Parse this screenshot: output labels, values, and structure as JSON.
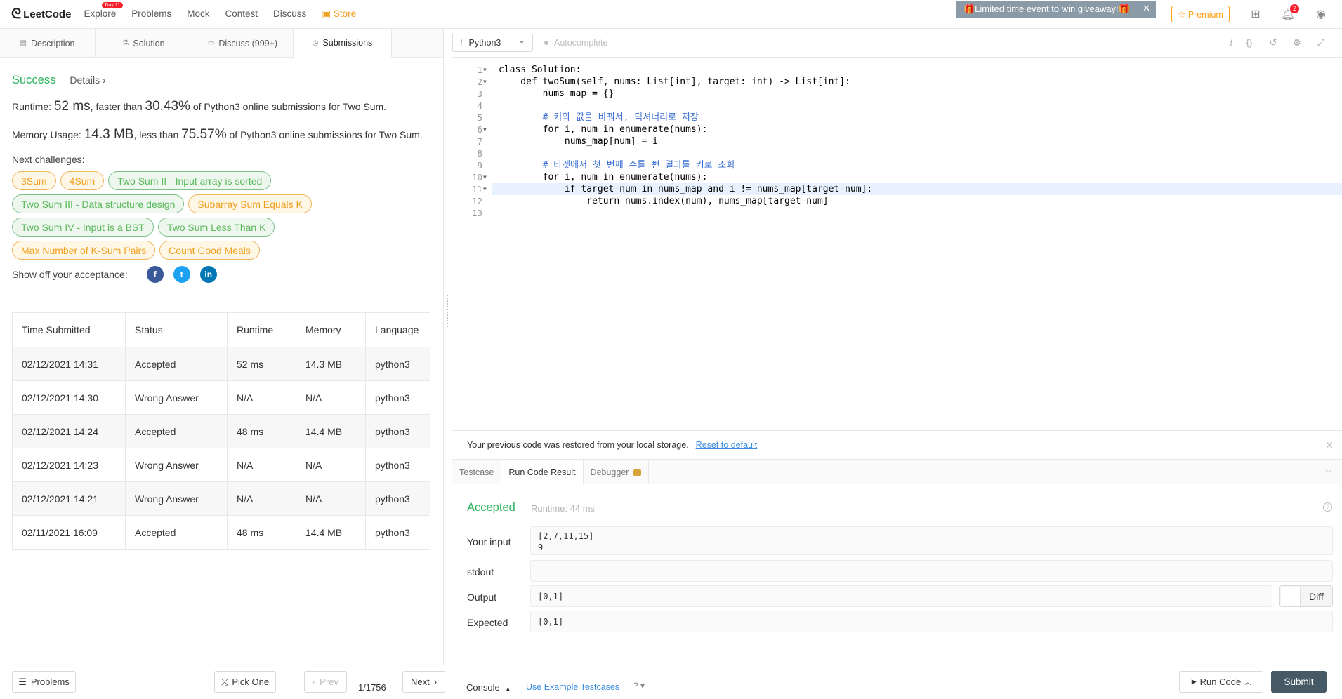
{
  "nav": {
    "brand": "LeetCode",
    "items": [
      {
        "label": "Explore",
        "badge": "Day 11"
      },
      {
        "label": "Problems"
      },
      {
        "label": "Mock"
      },
      {
        "label": "Contest"
      },
      {
        "label": "Discuss"
      },
      {
        "label": "Store",
        "icon": "gift-icon"
      }
    ],
    "promo": "🎁Limited time event to win giveaway!🎁",
    "premium": "☆ Premium",
    "notification_count": "2"
  },
  "tabs": [
    {
      "label": "Description",
      "icon": "file-icon"
    },
    {
      "label": "Solution",
      "icon": "flask-icon"
    },
    {
      "label": "Discuss (999+)",
      "icon": "chat-icon"
    },
    {
      "label": "Submissions",
      "icon": "clock-icon",
      "active": true
    }
  ],
  "result_summary": {
    "status": "Success",
    "details": "Details",
    "runtime_prefix": "Runtime: ",
    "runtime_value": "52 ms",
    "runtime_mid": ", faster than ",
    "runtime_pct": "30.43%",
    "runtime_suffix": " of Python3 online submissions for Two Sum.",
    "memory_prefix": "Memory Usage: ",
    "memory_value": "14.3 MB",
    "memory_mid": ", less than ",
    "memory_pct": "75.57%",
    "memory_suffix": " of Python3 online submissions for Two Sum."
  },
  "next_challenges": {
    "label": "Next challenges:",
    "rows": [
      [
        {
          "name": "3Sum",
          "level": "medium"
        },
        {
          "name": "4Sum",
          "level": "medium"
        },
        {
          "name": "Two Sum II - Input array is sorted",
          "level": "easy"
        }
      ],
      [
        {
          "name": "Two Sum III - Data structure design",
          "level": "easy"
        },
        {
          "name": "Subarray Sum Equals K",
          "level": "medium"
        }
      ],
      [
        {
          "name": "Two Sum IV - Input is a BST",
          "level": "easy"
        },
        {
          "name": "Two Sum Less Than K",
          "level": "easy"
        }
      ],
      [
        {
          "name": "Max Number of K-Sum Pairs",
          "level": "medium"
        },
        {
          "name": "Count Good Meals",
          "level": "medium"
        }
      ]
    ]
  },
  "share": {
    "label": "Show off your acceptance:",
    "fb": "f",
    "tw": "t",
    "li": "in"
  },
  "submissions": {
    "headers": [
      "Time Submitted",
      "Status",
      "Runtime",
      "Memory",
      "Language"
    ],
    "rows": [
      [
        "02/12/2021 14:31",
        "Accepted",
        "52 ms",
        "14.3 MB",
        "python3"
      ],
      [
        "02/12/2021 14:30",
        "Wrong Answer",
        "N/A",
        "N/A",
        "python3"
      ],
      [
        "02/12/2021 14:24",
        "Accepted",
        "48 ms",
        "14.4 MB",
        "python3"
      ],
      [
        "02/12/2021 14:23",
        "Wrong Answer",
        "N/A",
        "N/A",
        "python3"
      ],
      [
        "02/12/2021 14:21",
        "Wrong Answer",
        "N/A",
        "N/A",
        "python3"
      ],
      [
        "02/11/2021 16:09",
        "Accepted",
        "48 ms",
        "14.4 MB",
        "python3"
      ]
    ]
  },
  "editor": {
    "language": "Python3",
    "autocomplete": "Autocomplete",
    "line_numbers": [
      "1",
      "2",
      "3",
      "4",
      "5",
      "6",
      "7",
      "8",
      "9",
      "10",
      "11",
      "12",
      "13"
    ],
    "code": [
      "class Solution:",
      "    def twoSum(self, nums: List[int], target: int) -> List[int]:",
      "        nums_map = {}",
      "",
      "        # 키와 값을 바꿔서, 딕셔너리로 저장",
      "        for i, num in enumerate(nums):",
      "            nums_map[num] = i",
      "",
      "        # 타겟에서 첫 번째 수를 뺀 결과를 키로 조회",
      "        for i, num in enumerate(nums):",
      "            if target-num in nums_map and i != nums_map[target-num]:",
      "                return nums.index(num), nums_map[target-num]",
      ""
    ]
  },
  "restore": {
    "message": "Your previous code was restored from your local storage.",
    "reset": "Reset to default"
  },
  "result_tabs": [
    {
      "label": "Testcase"
    },
    {
      "label": "Run Code Result",
      "active": true
    },
    {
      "label": "Debugger",
      "locked": true
    }
  ],
  "run_result": {
    "status": "Accepted",
    "runtime": "Runtime: 44 ms",
    "input_label": "Your input",
    "input_value": "[2,7,11,15]\n9",
    "stdout_label": "stdout",
    "stdout_value": "",
    "output_label": "Output",
    "output_value": "[0,1]",
    "expected_label": "Expected",
    "expected_value": "[0,1]",
    "diff": "Diff"
  },
  "bottom": {
    "problems": "Problems",
    "pick_one": "Pick One",
    "prev": "Prev",
    "page": "1/1756",
    "next": "Next",
    "console": "Console",
    "use_example": "Use Example Testcases",
    "run_code": "Run Code",
    "submit": "Submit"
  },
  "colors": {
    "accepted": "#2db55d",
    "wrong": "#d9423c",
    "premium": "#ffa116",
    "submit": "#455a64"
  }
}
